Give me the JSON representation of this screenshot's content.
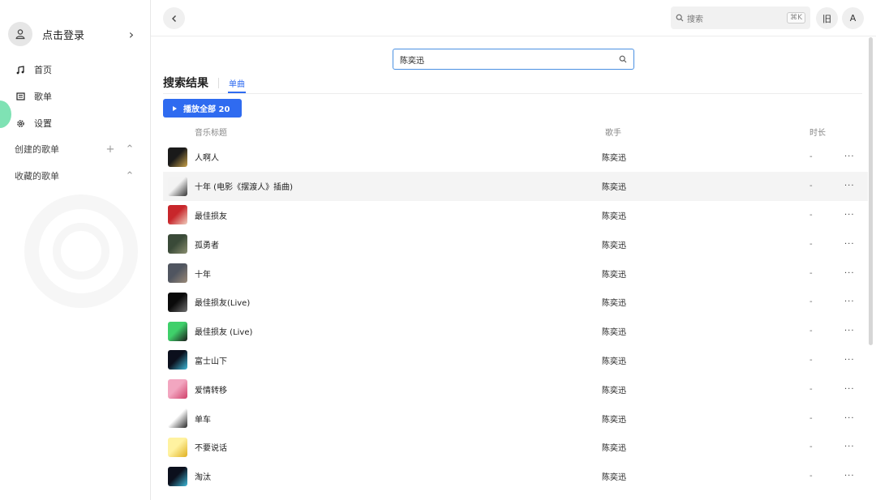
{
  "sidebar": {
    "login_label": "点击登录",
    "nav": [
      {
        "label": "首页",
        "icon": "music-note-icon"
      },
      {
        "label": "歌单",
        "icon": "list-icon"
      },
      {
        "label": "设置",
        "icon": "gear-icon"
      }
    ],
    "created_playlists_label": "创建的歌单",
    "collected_playlists_label": "收藏的歌单"
  },
  "topbar": {
    "search_placeholder": "搜索",
    "search_shortcut": "⌘K",
    "btn_old": "旧",
    "btn_account": "A"
  },
  "search": {
    "query": "陈奕迅"
  },
  "results": {
    "title": "搜索结果",
    "tab_single": "单曲",
    "play_all_label": "播放全部 20",
    "columns": {
      "title": "音乐标题",
      "artist": "歌手",
      "duration": "时长"
    },
    "songs": [
      {
        "title": "人啊人",
        "artist": "陈奕迅",
        "duration": "-",
        "cover_colors": [
          "#1a1a1a",
          "#c9a24a"
        ]
      },
      {
        "title": "十年 (电影《摆渡人》插曲)",
        "artist": "陈奕迅",
        "duration": "-",
        "cover_colors": [
          "#f3f3f3",
          "#333333"
        ]
      },
      {
        "title": "最佳损友",
        "artist": "陈奕迅",
        "duration": "-",
        "cover_colors": [
          "#c8262b",
          "#f0d0c0"
        ]
      },
      {
        "title": "孤勇者",
        "artist": "陈奕迅",
        "duration": "-",
        "cover_colors": [
          "#3a4a38",
          "#8a8f70"
        ]
      },
      {
        "title": "十年",
        "artist": "陈奕迅",
        "duration": "-",
        "cover_colors": [
          "#505560",
          "#9a8a78"
        ]
      },
      {
        "title": "最佳损友(Live)",
        "artist": "陈奕迅",
        "duration": "-",
        "cover_colors": [
          "#0a0a0a",
          "#707070"
        ]
      },
      {
        "title": "最佳损友 (Live)",
        "artist": "陈奕迅",
        "duration": "-",
        "cover_colors": [
          "#3fd06a",
          "#1a1a1a"
        ]
      },
      {
        "title": "富士山下",
        "artist": "陈奕迅",
        "duration": "-",
        "cover_colors": [
          "#0b0f1c",
          "#3fb8d8"
        ]
      },
      {
        "title": "爱情转移",
        "artist": "陈奕迅",
        "duration": "-",
        "cover_colors": [
          "#f2a6c0",
          "#d0406a"
        ]
      },
      {
        "title": "单车",
        "artist": "陈奕迅",
        "duration": "-",
        "cover_colors": [
          "#ffffff",
          "#2a2a2a"
        ]
      },
      {
        "title": "不要说话",
        "artist": "陈奕迅",
        "duration": "-",
        "cover_colors": [
          "#fff2a0",
          "#e0b020"
        ]
      },
      {
        "title": "淘汰",
        "artist": "陈奕迅",
        "duration": "-",
        "cover_colors": [
          "#0b0f1c",
          "#3fb8d8"
        ]
      }
    ],
    "more_label": "···"
  },
  "colors": {
    "accent": "#2f6bf0",
    "input_border": "#4a90e2"
  }
}
